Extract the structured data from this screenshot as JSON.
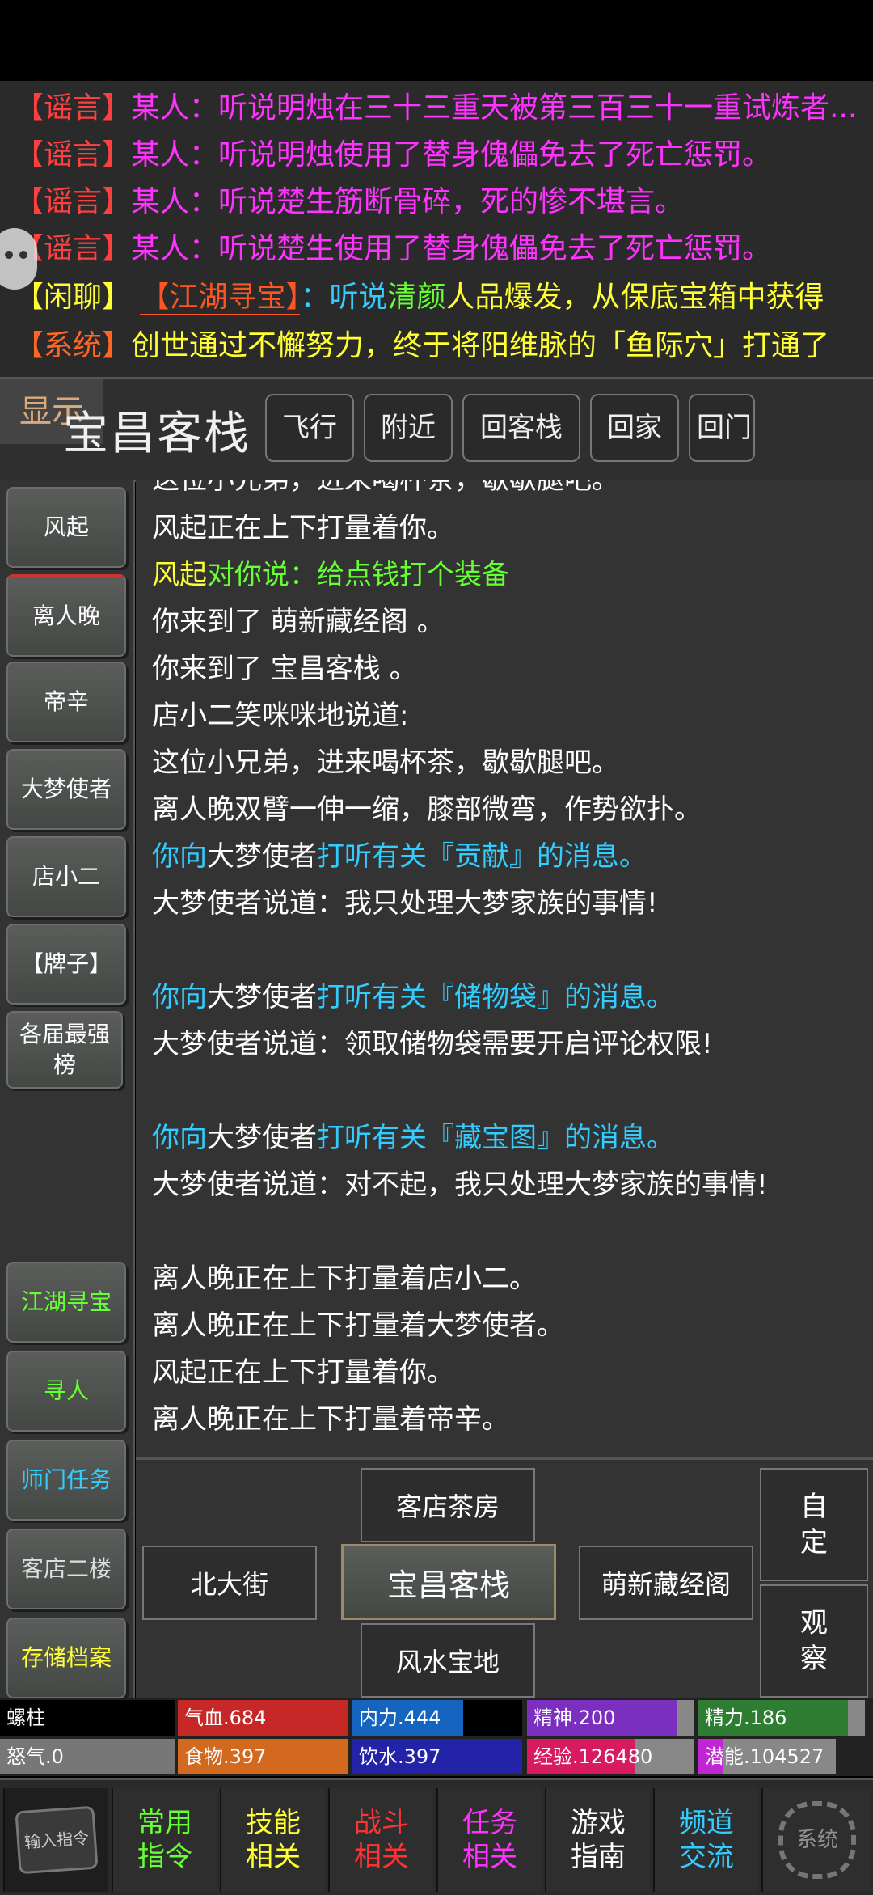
{
  "ticker": {
    "lines": [
      {
        "tag": "【谣言】",
        "speaker": "某人：",
        "text": "听说明烛在三十三重天被第三百三十一重试炼者..."
      },
      {
        "tag": "【谣言】",
        "speaker": "某人：",
        "text": "听说明烛使用了替身傀儡免去了死亡惩罚。"
      },
      {
        "tag": "【谣言】",
        "speaker": "某人：",
        "text": "听说楚生筋断骨碎，死的惨不堪言。"
      },
      {
        "tag": "【谣言】",
        "speaker": "某人：",
        "text": "听说楚生使用了替身傀儡免去了死亡惩罚。"
      }
    ],
    "chat": {
      "tag": "【闲聊】",
      "link": "【江湖寻宝】",
      "pre": "：听说",
      "name": "清颜",
      "text": "人品爆发，从保底宝箱中获得"
    },
    "system": {
      "tag": "【系统】",
      "text": "创世通过不懈努力，终于将阳维脉的「鱼际穴」打通了"
    }
  },
  "location": {
    "title": "宝昌客栈",
    "nav": [
      "飞行",
      "附近",
      "回客栈",
      "回家",
      "回门"
    ],
    "show": "显示"
  },
  "npcs": [
    "风起",
    "离人晚",
    "帝辛",
    "大梦使者",
    "店小二",
    "【牌子】",
    "各届最强榜"
  ],
  "actions": [
    "江湖寻宝",
    "寻人",
    "师门任务",
    "客店二楼",
    "存储档案"
  ],
  "messages": {
    "m0": "这位小兄弟，进来喝杯茶，歇歇腿吧。",
    "m1": "风起正在上下打量着你。",
    "m2a": "风起",
    "m2b": "对你说：",
    "m2c": "给点钱打个装备",
    "m3": "你来到了 萌新藏经阁 。",
    "m4": "你来到了 宝昌客栈 。",
    "m5": "店小二笑咪咪地说道:",
    "m6": "这位小兄弟，进来喝杯茶，歇歇腿吧。",
    "m7": "离人晚双臂一伸一缩，膝部微弯，作势欲扑。",
    "m8a": "你向",
    "m8b": "大梦使者",
    "m8c": "打听有关『贡献』的消息。",
    "m9": "大梦使者说道：我只处理大梦家族的事情!",
    "m10a": "你向",
    "m10b": "大梦使者",
    "m10c": "打听有关『储物袋』的消息。",
    "m11": "大梦使者说道：领取储物袋需要开启评论权限!",
    "m12a": "你向",
    "m12b": "大梦使者",
    "m12c": "打听有关『藏宝图』的消息。",
    "m13": "大梦使者说道：对不起，我只处理大梦家族的事情!",
    "m14": "离人晚正在上下打量着店小二。",
    "m15": "离人晚正在上下打量着大梦使者。",
    "m16": "风起正在上下打量着你。",
    "m17": "离人晚正在上下打量着帝辛。"
  },
  "exits": {
    "north": "客店茶房",
    "west": "北大街",
    "current": "宝昌客栈",
    "east": "萌新藏经阁",
    "south": "风水宝地",
    "side1": "自定",
    "side2": "观察"
  },
  "stats": {
    "name": "螺柱",
    "hp": "气血.684",
    "hp_fill": 1.0,
    "neili": "内力.444",
    "neili_fill": 0.65,
    "jingshen": "精神.200",
    "jingshen_fill": 0.9,
    "jingli": "精力.186",
    "jingli_fill": 0.9,
    "nuqi": "怒气.0",
    "nuqi_fill": 1.0,
    "food": "食物.397",
    "food_fill": 1.0,
    "water": "饮水.397",
    "water_fill": 1.0,
    "exp": "经验.126480",
    "exp_fill": 0.65,
    "qianneng": "潜能.104527",
    "qianneng_fill": 0.18
  },
  "toolbar": {
    "input": "输入指令",
    "items": [
      {
        "l1": "常用",
        "l2": "指令",
        "color": "#66ff33"
      },
      {
        "l1": "技能",
        "l2": "相关",
        "color": "#ffff33"
      },
      {
        "l1": "战斗",
        "l2": "相关",
        "color": "#ff3333"
      },
      {
        "l1": "任务",
        "l2": "相关",
        "color": "#ff33ff"
      },
      {
        "l1": "游戏",
        "l2": "指南",
        "color": "#ffffff"
      },
      {
        "l1": "频道",
        "l2": "交流",
        "color": "#33ccff"
      }
    ],
    "settings": "系统"
  },
  "colors": {
    "accent_red": "#ff4040",
    "magenta": "#ff33ff",
    "cyan": "#33ccff",
    "yellow": "#ffff33",
    "green": "#66ff33"
  }
}
